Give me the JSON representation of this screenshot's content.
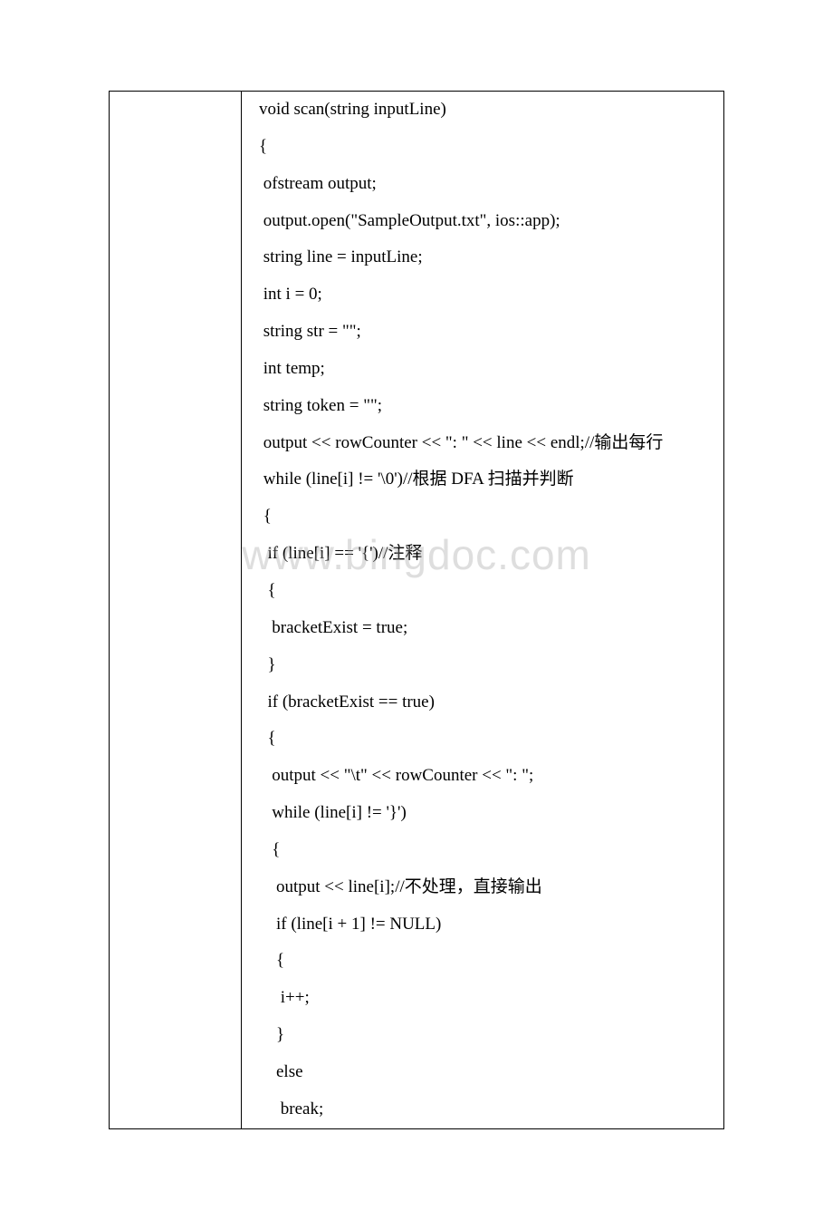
{
  "watermark": "www.bingdoc.com",
  "code": {
    "lines": [
      "    void scan(string inputLine)",
      "    {",
      "     ofstream output;",
      "     output.open(\"SampleOutput.txt\", ios::app);",
      "     string line = inputLine;",
      "     int i = 0;",
      "     string str = \"\";",
      "     int temp;",
      "     string token = \"\";",
      "     output << rowCounter << \": \" << line << endl;//输出每行",
      "     while (line[i] != '\\0')//根据 DFA 扫描并判断",
      "     {",
      "      if (line[i] == '{')//注释",
      "      {",
      "       bracketExist = true;",
      "      }",
      "      if (bracketExist == true)",
      "      {",
      "       output << \"\\t\" << rowCounter << \": \";",
      "       while (line[i] != '}')",
      "       {",
      "        output << line[i];//不处理，直接输出",
      "        if (line[i + 1] != NULL)",
      "        {",
      "         i++;",
      "        }",
      "        else",
      "         break;"
    ]
  }
}
